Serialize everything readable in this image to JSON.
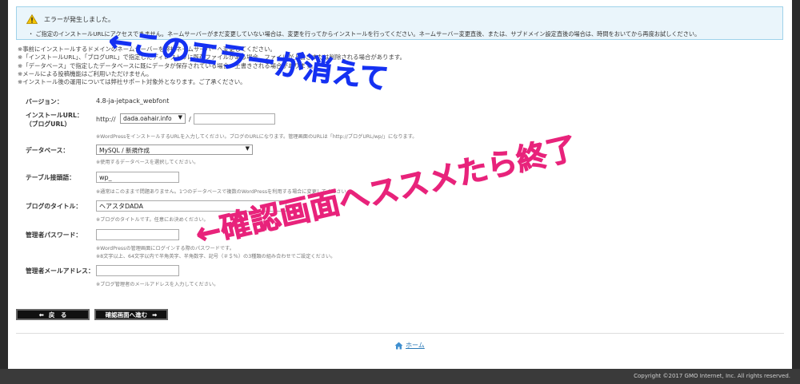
{
  "error": {
    "title": "エラーが発生しました。",
    "message": "・ ご指定のインストールURLにアクセスできません。ネームサーバーがまだ変更していない場合は、変更を行ってからインストールを行ってください。ネームサーバー変更直後、または、サブドメイン設定直後の場合は、時間をおいてから再度お試しください。"
  },
  "notes": [
    "※事前にインストールするドメインのネームサーバーを弊社ネームサーバーへ変更してください。",
    "※「インストールURL」、「ブログURL」で指定したディレクトリに既存ファイルがある場合、ファイルが上書きまたは削除される場合があります。",
    "※「データベース」で指定したデータベースに既にデータが保存されている場合、上書きされる場合があります。",
    "※メールによる投稿機能はご利用いただけません。",
    "※インストール後の運用については弊社サポート対象外となります。ご了承ください。"
  ],
  "form": {
    "version": {
      "label": "バージョン：",
      "value": "4.8-ja-jetpack_webfont"
    },
    "install_url": {
      "label": "インストールURL：",
      "label2": "（ブログURL）",
      "prefix": "http://",
      "domain": "dada.oahair.info",
      "slash": "/",
      "path": "",
      "hint": "※WordPressをインストールするURLを入力してください。ブログのURLになります。管理画面のURLは「http://ブログURL/wp/」になります。"
    },
    "database": {
      "label": "データベース：",
      "value": "MySQL / 新規作成",
      "hint": "※使用するデータベースを選択してください。"
    },
    "table_prefix": {
      "label": "テーブル接頭語：",
      "value": "wp_",
      "hint": "※通常はこのままで問題ありません。1つのデータベースで複数のWordPressを利用する場合に変更してください。"
    },
    "blog_title": {
      "label": "ブログのタイトル：",
      "value": "ヘアスタDADA",
      "hint": "※ブログのタイトルです。任意にお決めください。"
    },
    "admin_password": {
      "label": "管理者パスワード：",
      "value": "",
      "hint1": "※WordPressの管理画面にログインする際のパスワードです。",
      "hint2": "※8文字以上、64文字以内で半角英字、半角数字、記号（＃＄％）の3種類の組み合わせでご設定ください。"
    },
    "admin_email": {
      "label": "管理者メールアドレス：",
      "value": "",
      "hint": "※ブログ管理者のメールアドレスを入力してください。"
    }
  },
  "buttons": {
    "back": "戻　る",
    "confirm": "確認画面へ進む"
  },
  "home_link": "ホーム",
  "footer": "Copyright ©2017 GMO Internet, Inc. All rights reserved.",
  "annotations": {
    "top": "←このエラーが消えて",
    "bottom": "←確認画面へススメたら終了"
  },
  "colors": {
    "annotation_blue": "#1531f2",
    "annotation_pink": "#e8237b",
    "error_bg": "#eaf5fb"
  }
}
